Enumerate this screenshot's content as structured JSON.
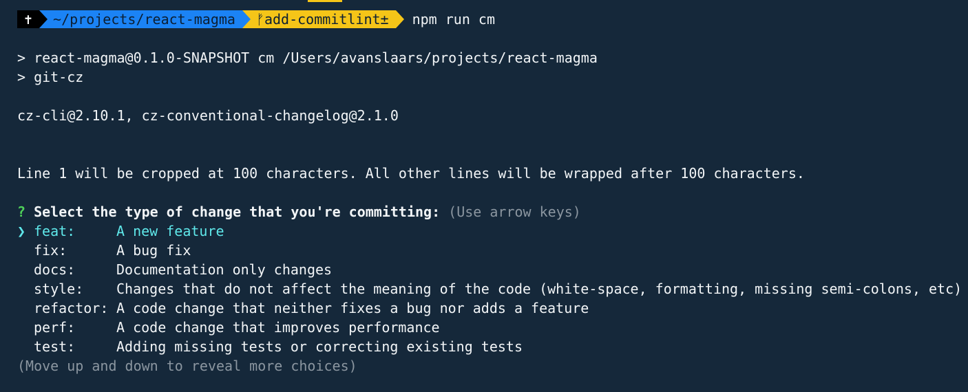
{
  "prompt": {
    "root_symbol": "✝",
    "path": "~/projects/react-magma",
    "branch_icon": "ᚠ",
    "branch": "add-commitlint±",
    "command": "npm run cm"
  },
  "output": {
    "script_line": "> react-magma@0.1.0-SNAPSHOT cm /Users/avanslaars/projects/react-magma",
    "subcommand_line": "> git-cz",
    "versions_line": "cz-cli@2.10.1, cz-conventional-changelog@2.1.0",
    "info_line": "Line 1 will be cropped at 100 characters. All other lines will be wrapped after 100 characters."
  },
  "question": {
    "mark": "?",
    "text": "Select the type of change that you're committing:",
    "hint": "(Use arrow keys)",
    "pointer": "❯",
    "choices": [
      {
        "name": "feat:",
        "description": "A new feature"
      },
      {
        "name": "fix:",
        "description": "A bug fix"
      },
      {
        "name": "docs:",
        "description": "Documentation only changes"
      },
      {
        "name": "style:",
        "description": "Changes that do not affect the meaning of the code (white-space, formatting, missing semi-colons, etc)"
      },
      {
        "name": "refactor:",
        "description": "A code change that neither fixes a bug nor adds a feature"
      },
      {
        "name": "perf:",
        "description": "A code change that improves performance"
      },
      {
        "name": "test:",
        "description": "Adding missing tests or correcting existing tests"
      }
    ],
    "footer": "(Move up and down to reveal more choices)"
  },
  "colors": {
    "background": "#15283a",
    "path_segment": "#1b83f5",
    "git_segment": "#f5c518",
    "selected_choice": "#5fe8ea",
    "question_mark": "#4fd15a",
    "dim_text": "#8b96a0"
  }
}
